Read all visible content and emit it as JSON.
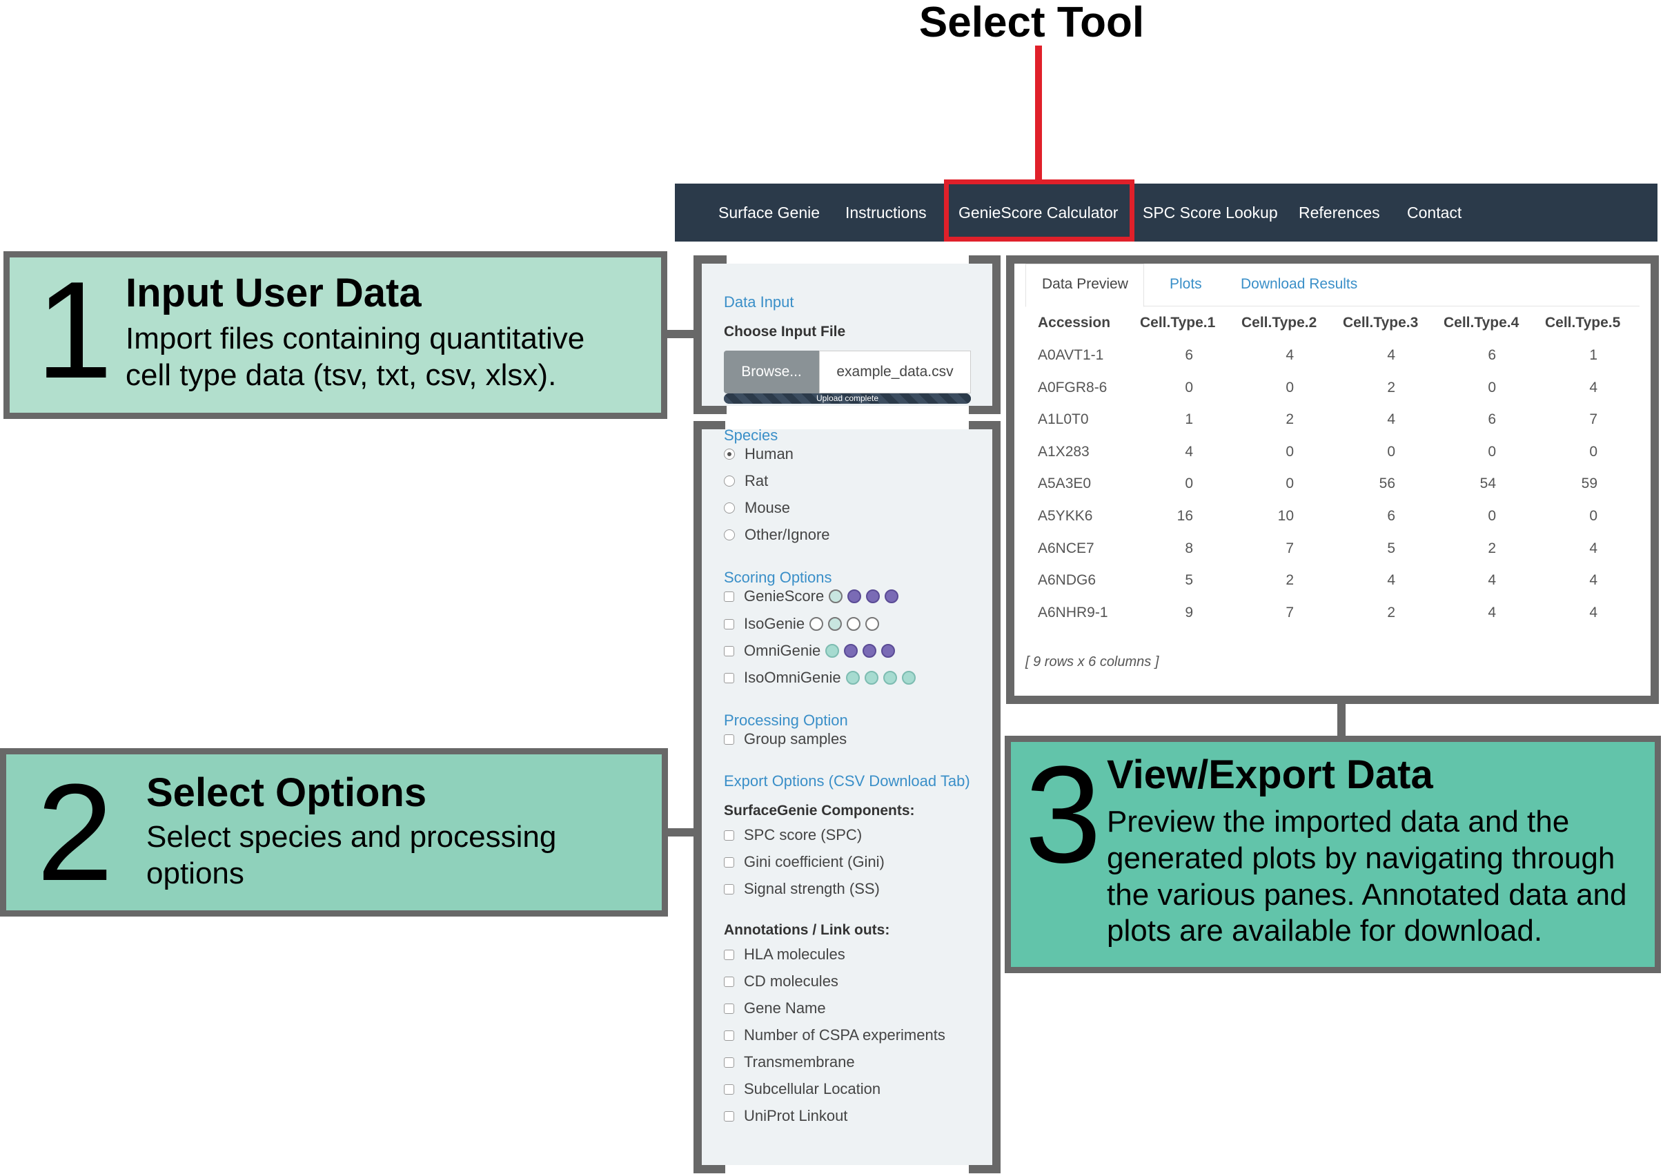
{
  "header": {
    "title": "Select Tool"
  },
  "nav": {
    "items": [
      "Surface Genie",
      "Instructions",
      "GenieScore Calculator",
      "SPC Score Lookup",
      "References",
      "Contact"
    ]
  },
  "callouts": {
    "c1": {
      "number": "1",
      "title": "Input User Data",
      "desc": "Import files containing quantitative cell type data (tsv, txt, csv, xlsx)."
    },
    "c2": {
      "number": "2",
      "title": "Select Options",
      "desc": "Select species and processing options"
    },
    "c3": {
      "number": "3",
      "title": "View/Export Data",
      "desc": "Preview the imported data and the generated plots by navigating through the various panes. Annotated data and plots are available for download."
    }
  },
  "input_panel": {
    "section": "Data Input",
    "label": "Choose Input File",
    "browse_label": "Browse...",
    "file_value": "example_data.csv",
    "progress_text": "Upload complete",
    "progress": 1.0
  },
  "options_panel": {
    "species_label": "Species",
    "species": [
      "Human",
      "Rat",
      "Mouse",
      "Other/Ignore"
    ],
    "species_selected": "Human",
    "scoring_label": "Scoring Options",
    "scoring": [
      "GenieScore",
      "IsoGenie",
      "OmniGenie",
      "IsoOmniGenie"
    ],
    "processing_label": "Processing Option",
    "processing": [
      "Group samples"
    ],
    "export_label": "Export Options (CSV Download Tab)",
    "components_label": "SurfaceGenie Components:",
    "components": [
      "SPC score (SPC)",
      "Gini coefficient (Gini)",
      "Signal strength (SS)"
    ],
    "annotations_label": "Annotations / Link outs:",
    "annotations": [
      "HLA molecules",
      "CD molecules",
      "Gene Name",
      "Number of CSPA experiments",
      "Transmembrane",
      "Subcellular Location",
      "UniProt Linkout"
    ]
  },
  "results_panel": {
    "tabs": [
      "Data Preview",
      "Plots",
      "Download Results"
    ],
    "active_tab": "Data Preview",
    "columns": [
      "Accession",
      "Cell.Type.1",
      "Cell.Type.2",
      "Cell.Type.3",
      "Cell.Type.4",
      "Cell.Type.5"
    ],
    "rows": [
      [
        "A0AVT1-1",
        "6",
        "4",
        "4",
        "6",
        "1"
      ],
      [
        "A0FGR8-6",
        "0",
        "0",
        "2",
        "0",
        "4"
      ],
      [
        "A1L0T0",
        "1",
        "2",
        "4",
        "6",
        "7"
      ],
      [
        "A1X283",
        "4",
        "0",
        "0",
        "0",
        "0"
      ],
      [
        "A5A3E0",
        "0",
        "0",
        "56",
        "54",
        "59"
      ],
      [
        "A5YKK6",
        "16",
        "10",
        "6",
        "0",
        "0"
      ],
      [
        "A6NCE7",
        "8",
        "7",
        "5",
        "2",
        "4"
      ],
      [
        "A6NDG6",
        "5",
        "2",
        "4",
        "4",
        "4"
      ],
      [
        "A6NHR9-1",
        "9",
        "7",
        "2",
        "4",
        "4"
      ]
    ],
    "summary": "[ 9 rows x 6 columns ]"
  },
  "colors": {
    "nav_bg": "#2b3a4a",
    "highlight": "#e0202a",
    "callout1": "#b2dfcd",
    "callout2": "#8fd1bb",
    "callout3": "#62c4aa",
    "link": "#3a8fc8"
  }
}
